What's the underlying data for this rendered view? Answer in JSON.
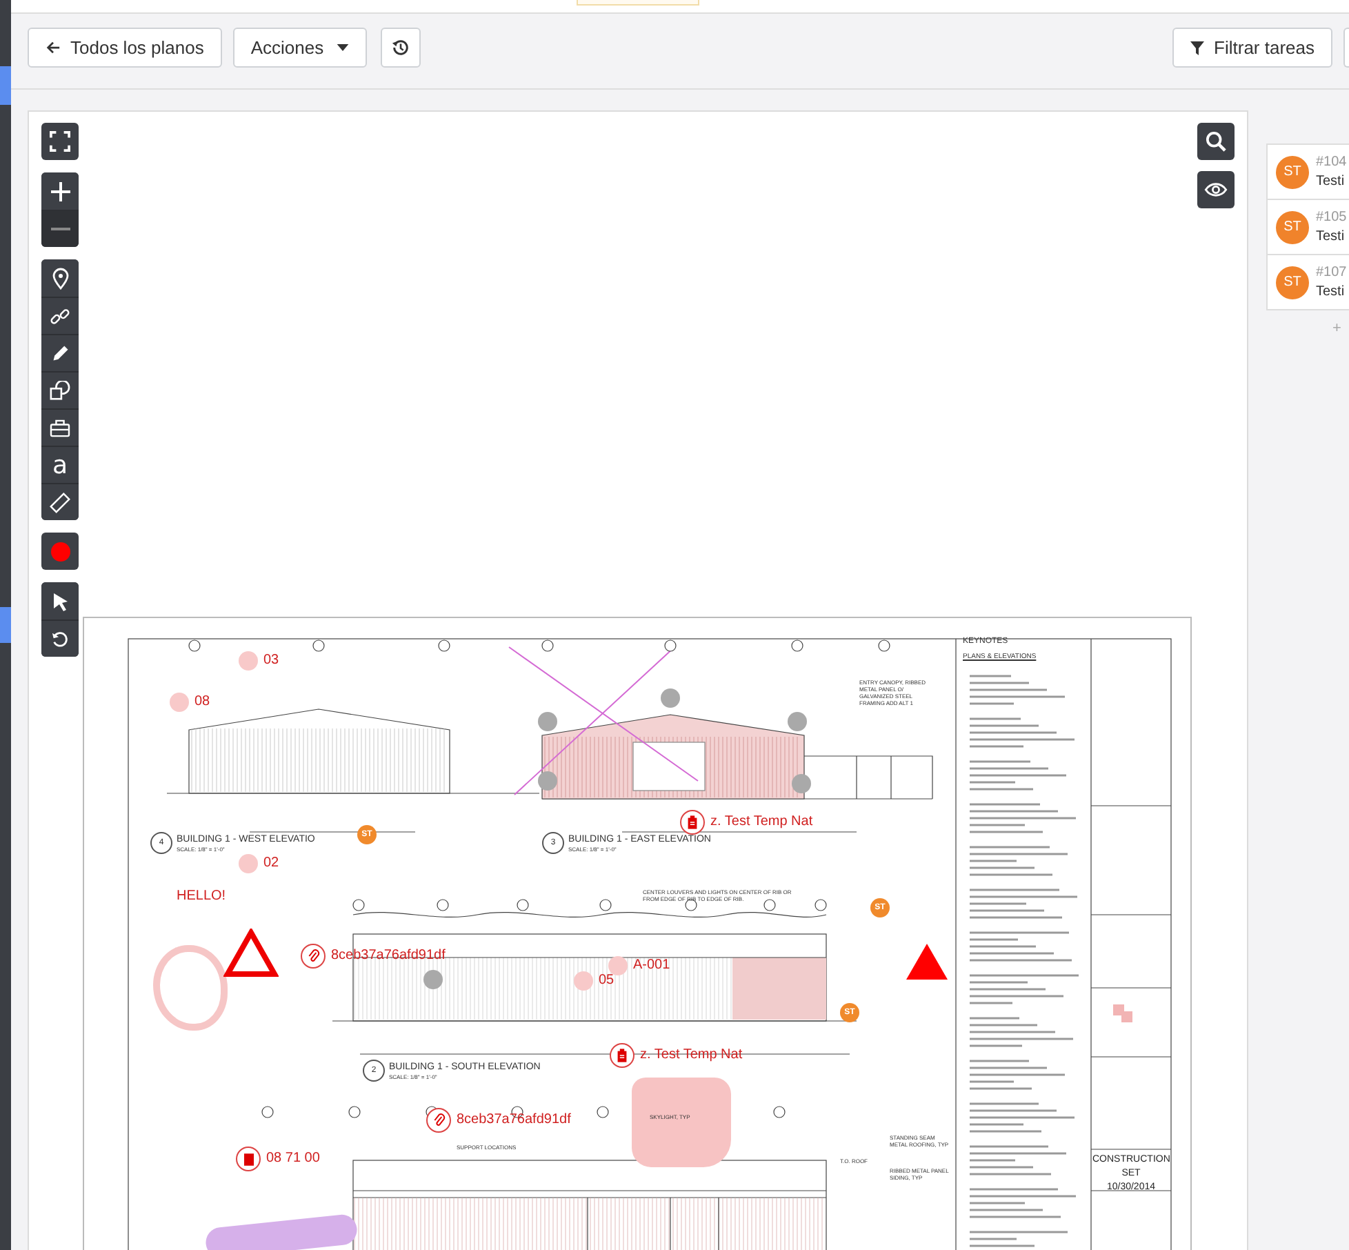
{
  "toolbar": {
    "back_button": "Todos los planos",
    "actions_button": "Acciones",
    "filter_button": "Filtrar tareas"
  },
  "viewer": {
    "tools": [
      {
        "kind": "fullscreen"
      },
      {
        "kind": "zoom-in"
      },
      {
        "kind": "zoom-out"
      },
      {
        "kind": "pin"
      },
      {
        "kind": "link"
      },
      {
        "kind": "pencil"
      },
      {
        "kind": "shapes"
      },
      {
        "kind": "toolbox"
      },
      {
        "kind": "text",
        "label": "a"
      },
      {
        "kind": "ruler"
      },
      {
        "kind": "color",
        "color": "#ff0000"
      },
      {
        "kind": "select"
      },
      {
        "kind": "undo"
      }
    ],
    "sheet": {
      "titles": [
        {
          "number": "4",
          "title": "BUILDING 1 - WEST ELEVATIO",
          "scale": "SCALE: 1/8\" = 1'-0\""
        },
        {
          "number": "3",
          "title": "BUILDING 1 - EAST ELEVATION",
          "scale": "SCALE: 1/8\" = 1'-0\""
        },
        {
          "number": "2",
          "title": "BUILDING 1 - SOUTH ELEVATION",
          "scale": "SCALE: 1/8\" = 1'-0\""
        }
      ],
      "notes": [
        "ENTRY CANOPY, RIBBED METAL PANEL O/ GALVANIZED STEEL FRAMING ADD ALT 1",
        "CENTER LOUVERS AND LIGHTS ON CENTER OF RIB OR FROM EDGE OF RIB TO EDGE OF RIB.",
        "SKYLIGHT, TYP",
        "SUPPORT LOCATIONS",
        "STANDING SEAM METAL ROOFING, TYP",
        "RIBBED METAL PANEL SIDING, TYP",
        "T.O. ROOF"
      ],
      "keynotes": {
        "title": "KEYNOTES",
        "section": "PLANS & ELEVATIONS"
      },
      "title_block": {
        "set": "CONSTRUCTION SET",
        "date": "10/30/2014"
      },
      "markups": [
        {
          "kind": "dot",
          "text": "03"
        },
        {
          "kind": "dot",
          "text": "08"
        },
        {
          "kind": "dot",
          "text": "02"
        },
        {
          "kind": "text",
          "text": "HELLO!"
        },
        {
          "kind": "clipboard",
          "text": "z. Test Temp Nat"
        },
        {
          "kind": "attachment",
          "text": "8ceb37a76afd91df"
        },
        {
          "kind": "dot",
          "text": "A-001"
        },
        {
          "kind": "dot",
          "text": "05"
        },
        {
          "kind": "clipboard",
          "text": "z. Test Temp Nat"
        },
        {
          "kind": "attachment",
          "text": "8ceb37a76afd91df"
        },
        {
          "kind": "document",
          "text": "08 71 00"
        }
      ],
      "pins": [
        {
          "label": "ST"
        },
        {
          "label": "ST"
        },
        {
          "label": "ST"
        }
      ]
    }
  },
  "tasks": [
    {
      "number": "#104",
      "title": "Testi",
      "label": "ST"
    },
    {
      "number": "#105",
      "title": "Testi",
      "label": "ST"
    },
    {
      "number": "#107",
      "title": "Testi",
      "label": "ST"
    }
  ],
  "add_label": "+"
}
